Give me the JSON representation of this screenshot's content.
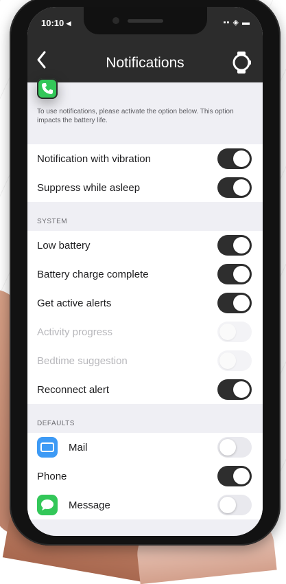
{
  "status_bar": {
    "time": "10:10 ◂",
    "indicators": "▪▪ ◈ ▬"
  },
  "nav": {
    "title": "Notifications",
    "back_icon": "chevron-left-icon",
    "watch_icon": "watch-icon"
  },
  "info_text": "To use notifications, please activate the option below. This option impacts the battery life.",
  "general": [
    {
      "label": "Notification with vibration",
      "on": true,
      "disabled": false
    },
    {
      "label": "Suppress while asleep",
      "on": true,
      "disabled": false
    }
  ],
  "system": {
    "header": "SYSTEM",
    "items": [
      {
        "label": "Low battery",
        "on": true,
        "disabled": false
      },
      {
        "label": "Battery charge complete",
        "on": true,
        "disabled": false
      },
      {
        "label": "Get active alerts",
        "on": true,
        "disabled": false
      },
      {
        "label": "Activity progress",
        "on": false,
        "disabled": true
      },
      {
        "label": "Bedtime suggestion",
        "on": false,
        "disabled": true
      },
      {
        "label": "Reconnect alert",
        "on": true,
        "disabled": false
      }
    ]
  },
  "defaults": {
    "header": "DEFAULTS",
    "items": [
      {
        "label": "Mail",
        "icon": "mail-icon",
        "on": false
      },
      {
        "label": "Phone",
        "icon": "phone-icon",
        "on": true
      },
      {
        "label": "Message",
        "icon": "message-icon",
        "on": false
      }
    ]
  },
  "colors": {
    "accent": "#2e2e2e",
    "nav_bg": "#2c2c2c",
    "bg": "#efeff4",
    "mail": "#3d9af5",
    "phone": "#33c759"
  }
}
